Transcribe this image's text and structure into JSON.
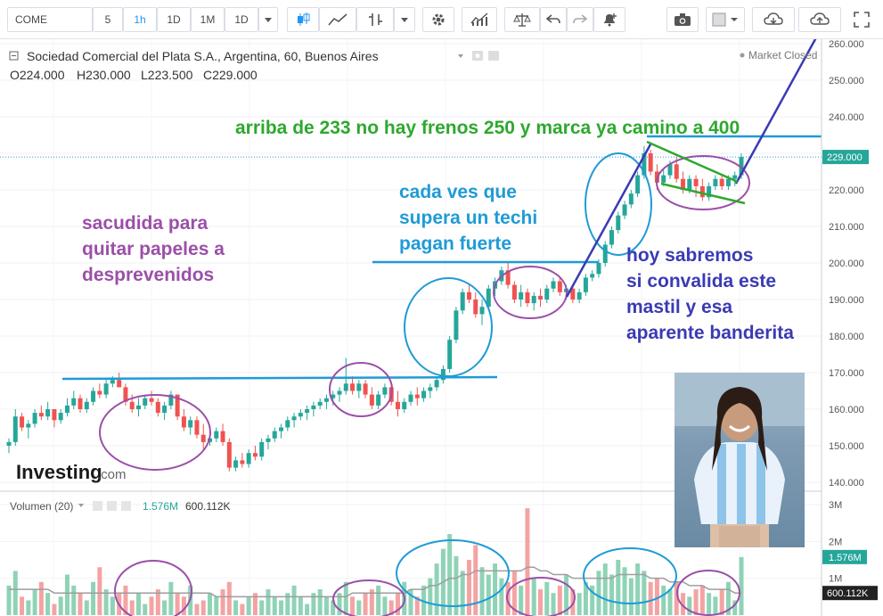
{
  "toolbar": {
    "symbol": "COME",
    "intervals": [
      "5",
      "1h",
      "1D",
      "1M",
      "1D"
    ],
    "active_interval": "1h"
  },
  "header": {
    "title": "Sociedad Comercial del Plata S.A., Argentina, 60, Buenos Aires",
    "status": "Market Closed",
    "ohlc": {
      "open": "O224.000",
      "high": "H230.000",
      "low": "L223.500",
      "close": "C229.000"
    }
  },
  "volume_header": {
    "label": "Volumen (20)",
    "value1": "1.576M",
    "value2": "600.112K"
  },
  "brand": {
    "name": "Investing",
    "suffix": ".com"
  },
  "colors": {
    "up": "#26a69a",
    "down": "#ef5350",
    "vol_up": "#8fd3b6",
    "vol_down": "#f4a3a3",
    "cyan": "#1e9bd7",
    "purple": "#9b4fa8",
    "blue": "#3a3ab5",
    "green": "#2ea82e"
  },
  "annotations": {
    "top": "arriba de 233 no hay frenos 250 y marca ya camino a 400",
    "cada": [
      "cada ves que",
      "supera un techi",
      "pagan fuerte"
    ],
    "sacudida": [
      "sacudida para",
      "quitar papeles a",
      "desprevenidos"
    ],
    "hoy": [
      "hoy sabremos",
      "si convalida este",
      "mastil y esa",
      "aparente banderita"
    ]
  },
  "chart_data": [
    {
      "type": "candlestick",
      "y_axis": {
        "ticks": [
          "260.000",
          "250.000",
          "240.000",
          "230.000",
          "220.000",
          "210.000",
          "200.000",
          "190.000",
          "180.000",
          "170.000",
          "160.000",
          "150.000",
          "140.000"
        ],
        "range": [
          136,
          263
        ],
        "last_price_label": "229.000",
        "last_price": 229
      },
      "series": [
        {
          "ohlc": [
            [
              150,
              152,
              148,
              151
            ],
            [
              151,
              160,
              150,
              158
            ],
            [
              158,
              159,
              154,
              155
            ],
            [
              155,
              157,
              152,
              156
            ],
            [
              156,
              160,
              155,
              159
            ],
            [
              159,
              161,
              157,
              158
            ],
            [
              158,
              162,
              157,
              160
            ],
            [
              160,
              159,
              155,
              157
            ],
            [
              157,
              160,
              156,
              159
            ],
            [
              159,
              163,
              158,
              161
            ],
            [
              161,
              165,
              160,
              163
            ],
            [
              163,
              164,
              159,
              160
            ],
            [
              160,
              163,
              159,
              162
            ],
            [
              162,
              166,
              161,
              165
            ],
            [
              165,
              167,
              163,
              164
            ],
            [
              164,
              168,
              163,
              167
            ],
            [
              167,
              169,
              166,
              168
            ],
            [
              168,
              170,
              167,
              166
            ],
            [
              166,
              167,
              161,
              162
            ],
            [
              162,
              164,
              159,
              160
            ],
            [
              160,
              163,
              158,
              161
            ],
            [
              161,
              164,
              160,
              163
            ],
            [
              163,
              165,
              161,
              162
            ],
            [
              162,
              163,
              158,
              159
            ],
            [
              159,
              162,
              157,
              161
            ],
            [
              161,
              165,
              160,
              164
            ],
            [
              164,
              162,
              157,
              158
            ],
            [
              158,
              160,
              154,
              155
            ],
            [
              155,
              158,
              153,
              157
            ],
            [
              157,
              158,
              152,
              153
            ],
            [
              153,
              156,
              149,
              151
            ],
            [
              151,
              154,
              150,
              152
            ],
            [
              152,
              155,
              151,
              154
            ],
            [
              154,
              156,
              150,
              151
            ],
            [
              151,
              152,
              143,
              144
            ],
            [
              144,
              147,
              143,
              146
            ],
            [
              146,
              148,
              144,
              145
            ],
            [
              145,
              149,
              144,
              148
            ],
            [
              148,
              150,
              146,
              147
            ],
            [
              147,
              152,
              146,
              151
            ],
            [
              151,
              153,
              149,
              152
            ],
            [
              152,
              155,
              151,
              154
            ],
            [
              154,
              156,
              152,
              155
            ],
            [
              155,
              158,
              154,
              157
            ],
            [
              157,
              159,
              155,
              158
            ],
            [
              158,
              160,
              157,
              159
            ],
            [
              159,
              161,
              157,
              160
            ],
            [
              160,
              162,
              158,
              161
            ],
            [
              161,
              163,
              160,
              162
            ],
            [
              162,
              164,
              160,
              163
            ],
            [
              163,
              165,
              161,
              164
            ],
            [
              164,
              166,
              162,
              165
            ],
            [
              165,
              174,
              164,
              167
            ],
            [
              167,
              169,
              164,
              165
            ],
            [
              165,
              168,
              163,
              167
            ],
            [
              167,
              168,
              163,
              164
            ],
            [
              164,
              166,
              160,
              161
            ],
            [
              161,
              165,
              160,
              164
            ],
            [
              164,
              167,
              163,
              166
            ],
            [
              166,
              167,
              161,
              162
            ],
            [
              162,
              165,
              158,
              160
            ],
            [
              160,
              163,
              159,
              162
            ],
            [
              162,
              165,
              161,
              164
            ],
            [
              164,
              166,
              161,
              163
            ],
            [
              163,
              166,
              162,
              165
            ],
            [
              165,
              167,
              163,
              166
            ],
            [
              166,
              169,
              165,
              168
            ],
            [
              168,
              172,
              167,
              171
            ],
            [
              171,
              180,
              170,
              179
            ],
            [
              179,
              188,
              178,
              187
            ],
            [
              187,
              193,
              186,
              192
            ],
            [
              192,
              194,
              189,
              190
            ],
            [
              190,
              192,
              185,
              186
            ],
            [
              186,
              190,
              183,
              188
            ],
            [
              188,
              194,
              187,
              193
            ],
            [
              193,
              196,
              191,
              195
            ],
            [
              195,
              199,
              194,
              198
            ],
            [
              198,
              200,
              193,
              194
            ],
            [
              194,
              195,
              189,
              190
            ],
            [
              190,
              194,
              188,
              192
            ],
            [
              192,
              193,
              188,
              189
            ],
            [
              189,
              192,
              187,
              191
            ],
            [
              191,
              193,
              188,
              190
            ],
            [
              190,
              194,
              189,
              193
            ],
            [
              193,
              196,
              192,
              195
            ],
            [
              195,
              196,
              191,
              192
            ],
            [
              192,
              194,
              190,
              193
            ],
            [
              193,
              194,
              189,
              190
            ],
            [
              190,
              193,
              189,
              192
            ],
            [
              192,
              197,
              191,
              196
            ],
            [
              196,
              198,
              195,
              197
            ],
            [
              197,
              201,
              196,
              200
            ],
            [
              200,
              206,
              199,
              205
            ],
            [
              205,
              210,
              204,
              209
            ],
            [
              209,
              214,
              208,
              213
            ],
            [
              213,
              217,
              212,
              216
            ],
            [
              216,
              220,
              215,
              219
            ],
            [
              219,
              225,
              218,
              224
            ],
            [
              224,
              232,
              223,
              230
            ],
            [
              230,
              231,
              224,
              225
            ],
            [
              225,
              227,
              220,
              222
            ],
            [
              222,
              226,
              221,
              224
            ],
            [
              224,
              228,
              223,
              227
            ],
            [
              227,
              229,
              222,
              223
            ],
            [
              223,
              225,
              219,
              220
            ],
            [
              220,
              224,
              219,
              223
            ],
            [
              223,
              224,
              218,
              221
            ],
            [
              221,
              223,
              217,
              218
            ],
            [
              218,
              222,
              217,
              221
            ],
            [
              221,
              224,
              220,
              223
            ],
            [
              223,
              224,
              220,
              221
            ],
            [
              221,
              224,
              220,
              223
            ],
            [
              223,
              225,
              221,
              224
            ],
            [
              224,
              230,
              223,
              229
            ]
          ]
        }
      ]
    },
    {
      "type": "bar",
      "title": "Volumen (20)",
      "y_axis": {
        "ticks": [
          "3M",
          "2M",
          "1M"
        ],
        "range": [
          0,
          3.2
        ]
      },
      "last_value_labels": [
        "1.576M",
        "600.112K"
      ],
      "values": [
        0.8,
        1.2,
        0.5,
        0.4,
        0.7,
        0.9,
        0.6,
        0.3,
        0.5,
        1.1,
        0.8,
        0.6,
        0.4,
        0.9,
        1.3,
        0.7,
        0.5,
        0.6,
        0.8,
        0.4,
        0.6,
        0.3,
        0.5,
        0.7,
        0.4,
        0.9,
        0.6,
        0.5,
        0.8,
        0.3,
        0.4,
        0.6,
        0.5,
        0.7,
        0.9,
        0.4,
        0.3,
        0.5,
        0.6,
        0.4,
        0.7,
        0.5,
        0.4,
        0.6,
        0.8,
        0.5,
        0.3,
        0.6,
        0.7,
        0.5,
        0.4,
        0.6,
        0.9,
        0.5,
        0.4,
        0.6,
        0.7,
        0.8,
        0.5,
        0.4,
        0.6,
        0.9,
        0.7,
        0.5,
        0.8,
        1.0,
        1.4,
        1.8,
        2.2,
        1.6,
        1.2,
        1.5,
        1.9,
        1.3,
        1.1,
        1.4,
        1.0,
        0.9,
        1.2,
        0.8,
        2.9,
        1.0,
        0.7,
        0.9,
        0.6,
        0.8,
        1.1,
        0.7,
        0.6,
        0.9,
        0.8,
        1.2,
        1.4,
        1.1,
        1.5,
        1.3,
        1.0,
        1.4,
        1.2,
        0.9,
        1.0,
        0.8,
        0.7,
        0.9,
        0.6,
        0.5,
        0.7,
        0.8,
        0.6,
        0.5,
        0.7,
        0.9,
        0.4,
        1.576
      ],
      "avg": [
        0.7,
        0.7,
        0.7,
        0.7,
        0.7,
        0.7,
        0.7,
        0.6,
        0.6,
        0.6,
        0.6,
        0.6,
        0.6,
        0.6,
        0.6,
        0.6,
        0.6,
        0.6,
        0.6,
        0.6,
        0.6,
        0.6,
        0.6,
        0.6,
        0.6,
        0.6,
        0.6,
        0.6,
        0.6,
        0.6,
        0.6,
        0.6,
        0.5,
        0.5,
        0.5,
        0.5,
        0.5,
        0.5,
        0.5,
        0.5,
        0.5,
        0.5,
        0.5,
        0.5,
        0.5,
        0.5,
        0.5,
        0.5,
        0.5,
        0.5,
        0.5,
        0.5,
        0.5,
        0.6,
        0.6,
        0.6,
        0.6,
        0.6,
        0.6,
        0.6,
        0.6,
        0.6,
        0.7,
        0.7,
        0.7,
        0.8,
        0.8,
        0.9,
        1.0,
        1.0,
        1.1,
        1.1,
        1.2,
        1.2,
        1.2,
        1.2,
        1.2,
        1.2,
        1.2,
        1.2,
        1.3,
        1.3,
        1.2,
        1.2,
        1.1,
        1.1,
        1.1,
        1.0,
        1.0,
        1.0,
        1.0,
        1.0,
        1.0,
        1.0,
        1.1,
        1.1,
        1.1,
        1.1,
        1.1,
        1.0,
        1.0,
        1.0,
        0.9,
        0.9,
        0.9,
        0.8,
        0.8,
        0.8,
        0.7,
        0.7,
        0.7,
        0.7,
        0.6,
        0.6
      ]
    }
  ]
}
